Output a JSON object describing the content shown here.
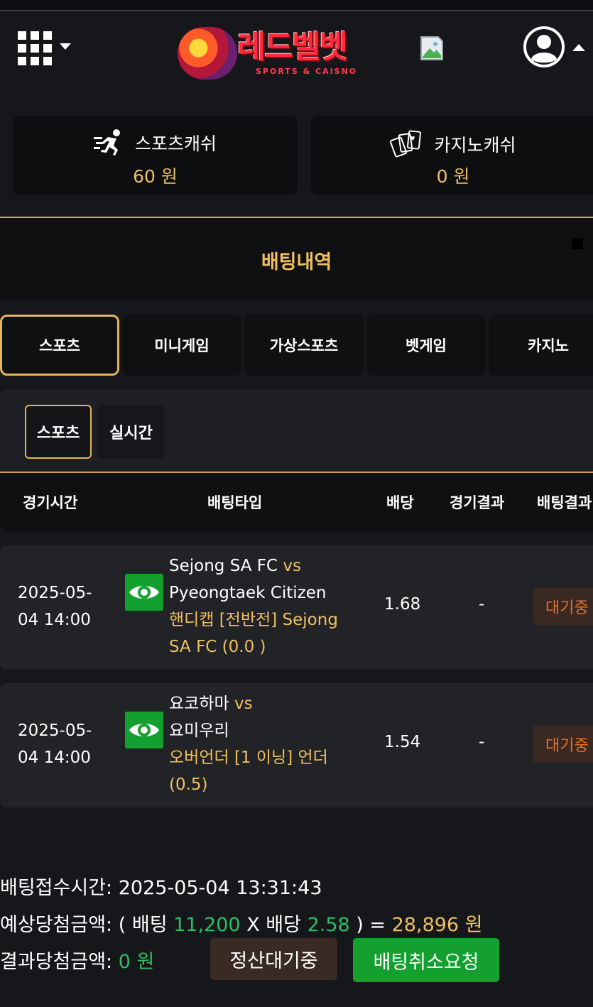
{
  "header": {
    "logo_text": "레드벨벳",
    "logo_sub": "SPORTS & CAISNO"
  },
  "balances": {
    "sports": {
      "label": "스포츠캐쉬",
      "value": "60 원"
    },
    "casino": {
      "label": "카지노캐쉬",
      "value": "0 원"
    }
  },
  "history_title": "배팅내역",
  "tabs": [
    "스포츠",
    "미니게임",
    "가상스포츠",
    "벳게임",
    "카지노"
  ],
  "subtabs": [
    "스포츠",
    "실시간"
  ],
  "table": {
    "headers": [
      "경기시간",
      "배팅타입",
      "배당",
      "경기결과",
      "배팅결과"
    ],
    "rows": [
      {
        "time_1": "2025-05-",
        "time_2": "04 14:00",
        "home": "Sejong SA FC",
        "vs": "vs",
        "away": "Pyeongtaek Citizen",
        "bet_1": "핸디캡 [전반전] Sejong",
        "bet_2": "SA FC (0.0 )",
        "odds": "1.68",
        "result": "-",
        "status": "대기중"
      },
      {
        "time_1": "2025-05-",
        "time_2": "04 14:00",
        "home": "요코하마",
        "vs": "vs",
        "away": "요미우리",
        "bet_1": "오버언더 [1 이닝] 언더",
        "bet_2": "(0.5)",
        "odds": "1.54",
        "result": "-",
        "status": "대기중"
      }
    ]
  },
  "summary": {
    "time_label": "배팅접수시간:",
    "time_value": "2025-05-04 13:31:43",
    "expected_label": "예상당첨금액:",
    "expected_open": "( 배팅",
    "bet_amount": "11,200",
    "x_label": "X 배당",
    "total_odds": "2.58",
    "expected_close": ") =",
    "expected_value": "28,896 원",
    "result_label": "결과당첨금액:",
    "result_value": "0 원",
    "wait_button": "정산대기중",
    "cancel_button": "배팅취소요청"
  },
  "colors": {
    "accent_gold": "#f0c060",
    "green": "#14a02f",
    "status_orange": "#e6702a"
  }
}
